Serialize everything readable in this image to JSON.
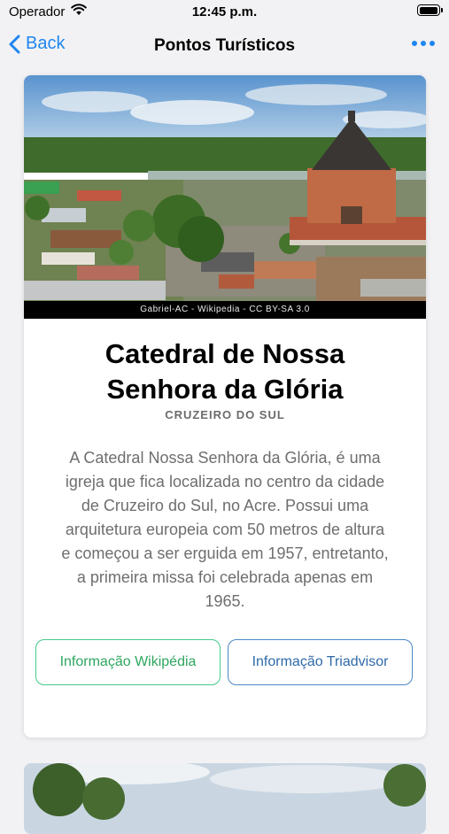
{
  "status_bar": {
    "carrier": "Operador",
    "time": "12:45 p.m."
  },
  "nav": {
    "back_label": "Back",
    "title": "Pontos Turísticos"
  },
  "card": {
    "photo_credit": "Gabriel-AC - Wikipedia - CC BY-SA 3.0",
    "title_line1": "Catedral de Nossa",
    "title_line2": "Senhora da Glória",
    "location": "CRUZEIRO DO SUL",
    "description_lines": [
      "A Catedral Nossa Senhora da Glória, é uma",
      "igreja que fica localizada no centro da cidade",
      "de Cruzeiro do Sul, no Acre. Possui uma",
      "arquitetura europeia com 50 metros de altura",
      "e começou a ser erguida em 1957, entretanto,",
      "a primeira missa foi celebrada apenas em",
      "1965."
    ],
    "button_wikipedia": "Informação Wikipédia",
    "button_tripadvisor": "Informação Triadvisor"
  },
  "colors": {
    "accent": "#1e86f0",
    "wiki_button": "#44c88a",
    "trip_button": "#4a88c7"
  }
}
